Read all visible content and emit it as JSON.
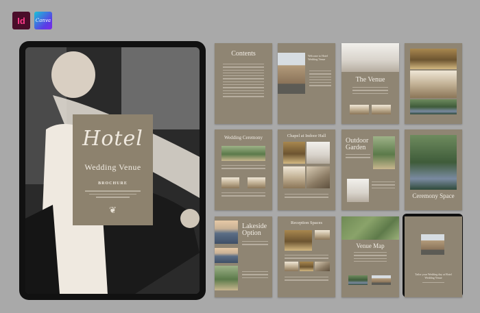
{
  "badges": {
    "indesign": "Id",
    "canva": "Canva"
  },
  "cover": {
    "script": "Hotel",
    "title": "Wedding Venue",
    "subtitle": "BROCHURE"
  },
  "pages": {
    "contents": "Contents",
    "welcome": "Welcome to Hotel Wedding Venue",
    "venue": "The Venue",
    "ceremony": "Wedding Ceremony",
    "chapel": "Chapel at Indoor Hall",
    "garden_line1": "Outdoor",
    "garden_line2": "Garden",
    "ceremony_space": "Ceremony Space",
    "lakeside_line1": "Lakeside",
    "lakeside_line2": "Option",
    "reception": "Reception Spaces",
    "map": "Venue Map",
    "final": "Tailor your Wedding day at Hotel Wedding Venue"
  }
}
